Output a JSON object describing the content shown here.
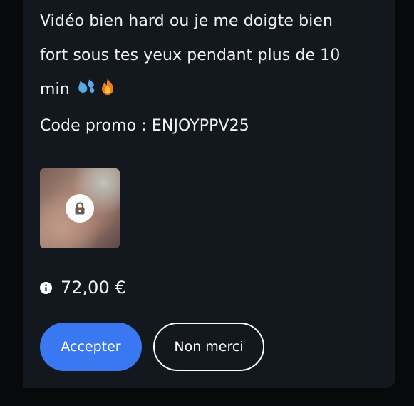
{
  "message": {
    "line1": "Vidéo bien hard ou je me doigte bien",
    "line2": "fort sous tes yeux pendant plus de 10",
    "line3": "min",
    "emojis": [
      "sweat-droplets-emoji",
      "fire-emoji"
    ],
    "promo": "Code promo : ENJOYPPV25"
  },
  "media": {
    "locked": true,
    "icon": "lock-icon"
  },
  "price": {
    "icon": "info-icon",
    "amount": "72,00 €"
  },
  "actions": {
    "accept_label": "Accepter",
    "decline_label": "Non merci"
  },
  "colors": {
    "background": "#08090b",
    "card": "#13171e",
    "accent": "#3a78f2",
    "text": "#f1f2f4"
  }
}
